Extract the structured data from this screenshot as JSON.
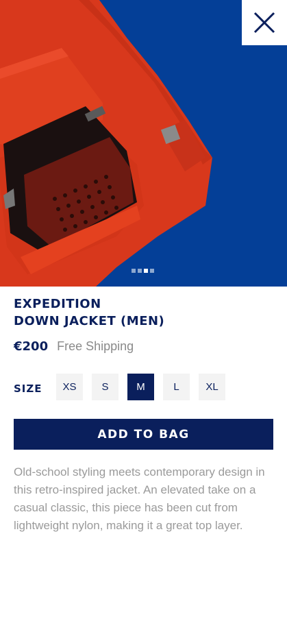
{
  "product": {
    "title_line1": "EXPEDITION",
    "title_line2": "DOWN JACKET (MEN)",
    "price": "€200",
    "shipping": "Free Shipping",
    "description": "Old-school styling meets contemporary design in this retro-inspired jacket. An elevated take on a casual classic, this piece has been cut from lightweight nylon, making it a great top layer."
  },
  "size": {
    "label": "SIZE",
    "options": [
      "XS",
      "S",
      "M",
      "L",
      "XL"
    ],
    "selected": "M"
  },
  "actions": {
    "add_to_bag": "ADD TO BAG"
  },
  "gallery": {
    "image_count": 4,
    "active_index": 2
  },
  "icons": {
    "close": "close-icon"
  },
  "colors": {
    "brand_navy": "#0a1f5c",
    "hero_blue": "#043f97",
    "jacket_red": "#d8381c",
    "muted_text": "#9a9a9a",
    "size_bg": "#f3f3f3"
  }
}
